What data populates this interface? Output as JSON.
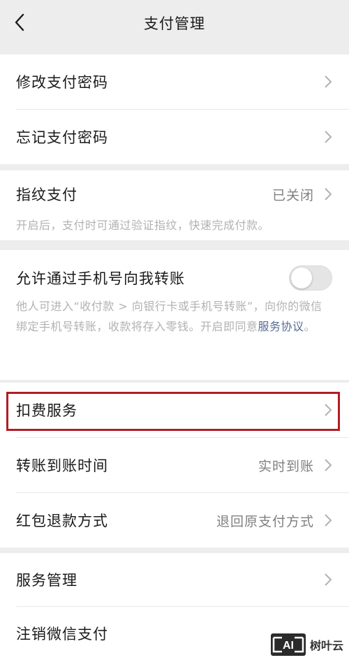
{
  "nav": {
    "title": "支付管理"
  },
  "group1": {
    "items": [
      {
        "label": "修改支付密码"
      },
      {
        "label": "忘记支付密码"
      }
    ]
  },
  "fingerprint": {
    "label": "指纹支付",
    "value": "已关闭",
    "desc": "开启后，支付时可通过验证指纹，快速完成付款。"
  },
  "phone_transfer": {
    "label": "允许通过手机号向我转账",
    "enabled": false,
    "desc_pre": "他人可进入“收付款 > 向银行卡或手机号转账”，向你的微信绑定手机号转账，收款将存入零钱。开启即同意",
    "desc_link": "服务协议",
    "desc_post": "。"
  },
  "group4": {
    "items": [
      {
        "label": "扣费服务",
        "value": ""
      },
      {
        "label": "转账到账时间",
        "value": "实时到账"
      },
      {
        "label": "红包退款方式",
        "value": "退回原支付方式"
      }
    ]
  },
  "group5": {
    "items": [
      {
        "label": "服务管理"
      },
      {
        "label": "注销微信支付"
      }
    ]
  },
  "watermark": {
    "logo_text": "AI",
    "text": "树叶云"
  },
  "colors": {
    "highlight": "#b01e24",
    "link": "#576b95",
    "background": "#ededed"
  }
}
